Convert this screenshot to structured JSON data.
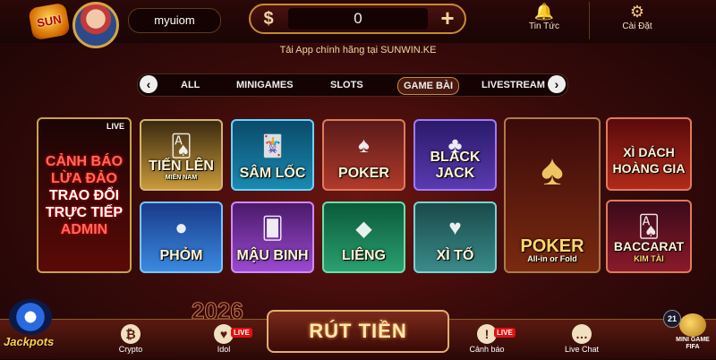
{
  "header": {
    "logo_text": "SUN",
    "username": "myuiom",
    "balance": {
      "currency_symbol": "$",
      "value": "0",
      "add_symbol": "+"
    },
    "news_label": "Tin Tức",
    "settings_label": "Cài Đặt",
    "app_line": "Tải App chính hãng tại SUNWIN.KE"
  },
  "tabs": {
    "items": [
      "ALL",
      "MINIGAMES",
      "SLOTS",
      "GAME BÀI",
      "LIVESTREAM"
    ],
    "active": "GAME BÀI",
    "prev": "‹",
    "next": "›"
  },
  "promo": {
    "live_tag": "LIVE",
    "lines": [
      "CẢNH BÁO",
      "LỪA ĐẢO",
      "TRAO ĐỔI",
      "TRỰC TIẾP",
      "ADMIN"
    ]
  },
  "games": {
    "tien_len": {
      "title": "TIẾN LÊN",
      "subtitle": "MIỀN NAM"
    },
    "sam_loc": "SÂM LỐC",
    "poker": "POKER",
    "black_jack": "BLACK JACK",
    "phom": "PHỎM",
    "mau_binh": "MẬU BINH",
    "lieng": "LIÊNG",
    "xi_to": "XÌ TỐ",
    "poker_big": {
      "title": "POKER",
      "subtitle": "All-in or Fold"
    },
    "xi_dach": "XÌ DÁCH HOÀNG GIA",
    "baccarat": {
      "title": "BACCARAT",
      "subtitle": "KIM TÀI"
    }
  },
  "bottom": {
    "year": "2026",
    "crypto": "Crypto",
    "idol": "Idol",
    "live_badge": "LIVE",
    "withdraw": "RÚT TIỀN",
    "warning": "Cảnh báo",
    "live_chat": "Live Chat",
    "jackpot": "Jackpots",
    "minigame_count": "21",
    "minigame_label": "MINI GAME",
    "minigame_sub": "FIFA"
  }
}
